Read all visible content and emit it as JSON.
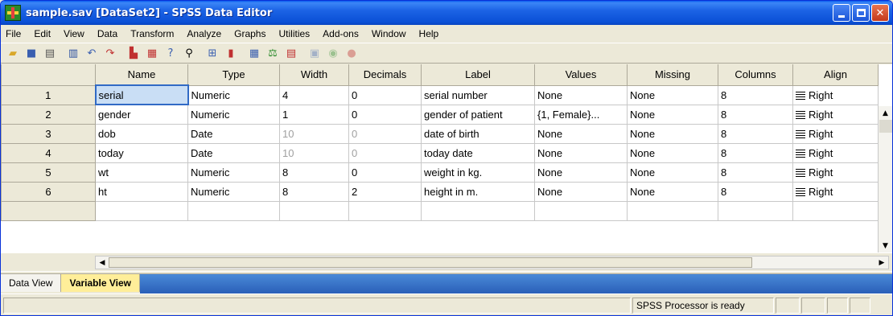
{
  "window": {
    "title": "sample.sav [DataSet2] - SPSS Data Editor"
  },
  "menu": [
    "File",
    "Edit",
    "View",
    "Data",
    "Transform",
    "Analyze",
    "Graphs",
    "Utilities",
    "Add-ons",
    "Window",
    "Help"
  ],
  "toolbar_icons": [
    "open-icon",
    "save-icon",
    "print-icon",
    "dialog-recall-icon",
    "undo-icon",
    "redo-icon",
    "goto-case-icon",
    "variables-icon",
    "find-icon",
    "insert-cases-icon",
    "insert-variable-icon",
    "split-file-icon",
    "weight-cases-icon",
    "select-cases-icon",
    "value-labels-icon",
    "use-sets-icon",
    "show-all-icon"
  ],
  "grid": {
    "columns": [
      "Name",
      "Type",
      "Width",
      "Decimals",
      "Label",
      "Values",
      "Missing",
      "Columns",
      "Align"
    ],
    "rows": [
      {
        "num": "1",
        "name": "serial",
        "type": "Numeric",
        "width": "4",
        "decimals": "0",
        "label": "serial number",
        "values": "None",
        "missing": "None",
        "columns": "8",
        "align": "Right"
      },
      {
        "num": "2",
        "name": "gender",
        "type": "Numeric",
        "width": "1",
        "decimals": "0",
        "label": "gender of patient",
        "values": "{1, Female}...",
        "missing": "None",
        "columns": "8",
        "align": "Right"
      },
      {
        "num": "3",
        "name": "dob",
        "type": "Date",
        "width": "10",
        "decimals": "0",
        "label": "date of birth",
        "values": "None",
        "missing": "None",
        "columns": "8",
        "align": "Right"
      },
      {
        "num": "4",
        "name": "today",
        "type": "Date",
        "width": "10",
        "decimals": "0",
        "label": "today date",
        "values": "None",
        "missing": "None",
        "columns": "8",
        "align": "Right"
      },
      {
        "num": "5",
        "name": "wt",
        "type": "Numeric",
        "width": "8",
        "decimals": "0",
        "label": "weight in kg.",
        "values": "None",
        "missing": "None",
        "columns": "8",
        "align": "Right"
      },
      {
        "num": "6",
        "name": "ht",
        "type": "Numeric",
        "width": "8",
        "decimals": "2",
        "label": "height in m.",
        "values": "None",
        "missing": "None",
        "columns": "8",
        "align": "Right"
      }
    ]
  },
  "tabs": {
    "data_view": "Data View",
    "variable_view": "Variable View",
    "active": "Variable View"
  },
  "status": {
    "processor": "SPSS  Processor is ready"
  },
  "colors": {
    "title_bar": "#0a5bef",
    "active_tab": "#ffee99",
    "selected_cell": "#c9def5"
  }
}
